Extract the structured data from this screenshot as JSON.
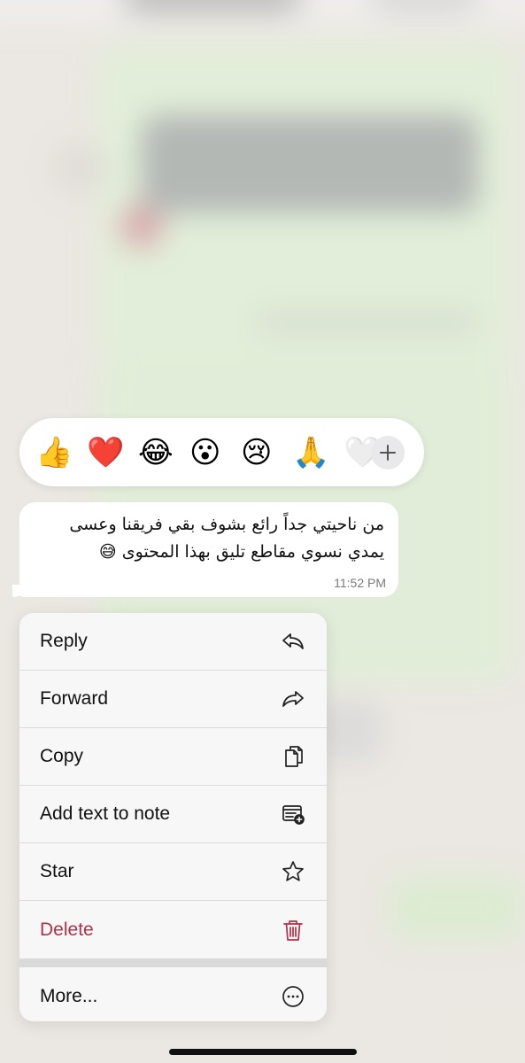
{
  "reactions": {
    "emojis": [
      "👍",
      "❤️",
      "😂",
      "😮",
      "😢",
      "🙏"
    ],
    "partial_emoji": "🤍",
    "more_icon": "plus-icon"
  },
  "message": {
    "text_line1": "من ناحيتي جداً رائع بشوف بقي فريقنا وعسى",
    "text_line2": "يمدي نسوي مقاطع تليق بهذا المحتوى 😅",
    "time": "11:52 PM"
  },
  "menu": {
    "items": [
      {
        "label": "Reply",
        "icon": "reply-icon"
      },
      {
        "label": "Forward",
        "icon": "forward-icon"
      },
      {
        "label": "Copy",
        "icon": "copy-icon"
      },
      {
        "label": "Add text to note",
        "icon": "add-to-note-icon"
      },
      {
        "label": "Star",
        "icon": "star-icon"
      },
      {
        "label": "Delete",
        "icon": "trash-icon"
      }
    ],
    "more": {
      "label": "More...",
      "icon": "more-icon"
    }
  },
  "colors": {
    "delete": "#b2304a",
    "bubble": "#ffffff",
    "menu_bg": "#f7f7f7"
  }
}
